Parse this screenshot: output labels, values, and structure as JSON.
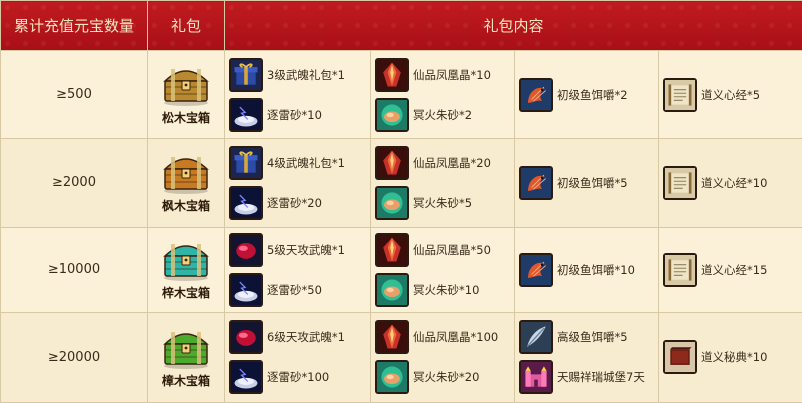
{
  "header": {
    "col_amount": "累计充值元宝数量",
    "col_pack": "礼包",
    "col_contents": "礼包内容"
  },
  "rows": [
    {
      "threshold": "≥500",
      "box": {
        "name": "松木宝箱",
        "color": "#b8892f"
      },
      "items": [
        [
          {
            "icon": "gift-box-icon",
            "label": "3级武魄礼包*1"
          },
          {
            "icon": "thunder-sand-icon",
            "label": "逐雷砂*10"
          }
        ],
        [
          {
            "icon": "phoenix-crystal-icon",
            "label": "仙品凤凰晶*10"
          },
          {
            "icon": "cinnabar-icon",
            "label": "冥火朱砂*2"
          }
        ],
        [
          {
            "icon": "shrimp-bait-icon",
            "label": "初级鱼饵嚼*2"
          }
        ],
        [
          {
            "icon": "scroll-book-icon",
            "label": "道义心经*5"
          }
        ]
      ]
    },
    {
      "threshold": "≥2000",
      "box": {
        "name": "枫木宝箱",
        "color": "#c67a22"
      },
      "items": [
        [
          {
            "icon": "gift-box-icon",
            "label": "4级武魄礼包*1"
          },
          {
            "icon": "thunder-sand-icon",
            "label": "逐雷砂*20"
          }
        ],
        [
          {
            "icon": "phoenix-crystal-icon",
            "label": "仙品凤凰晶*20"
          },
          {
            "icon": "cinnabar-icon",
            "label": "冥火朱砂*5"
          }
        ],
        [
          {
            "icon": "shrimp-bait-icon",
            "label": "初级鱼饵嚼*5"
          }
        ],
        [
          {
            "icon": "scroll-book-icon",
            "label": "道义心经*10"
          }
        ]
      ]
    },
    {
      "threshold": "≥10000",
      "box": {
        "name": "梓木宝箱",
        "color": "#2fb5a8"
      },
      "items": [
        [
          {
            "icon": "red-gem-icon",
            "label": "5级天攻武魄*1"
          },
          {
            "icon": "thunder-sand-icon",
            "label": "逐雷砂*50"
          }
        ],
        [
          {
            "icon": "phoenix-crystal-icon",
            "label": "仙品凤凰晶*50"
          },
          {
            "icon": "cinnabar-icon",
            "label": "冥火朱砂*10"
          }
        ],
        [
          {
            "icon": "shrimp-bait-icon",
            "label": "初级鱼饵嚼*10"
          }
        ],
        [
          {
            "icon": "scroll-book-icon",
            "label": "道义心经*15"
          }
        ]
      ]
    },
    {
      "threshold": "≥20000",
      "box": {
        "name": "樟木宝箱",
        "color": "#4eaa2c"
      },
      "items": [
        [
          {
            "icon": "red-gem-icon",
            "label": "6级天攻武魄*1"
          },
          {
            "icon": "thunder-sand-icon",
            "label": "逐雷砂*100"
          }
        ],
        [
          {
            "icon": "phoenix-crystal-icon",
            "label": "仙品凤凰晶*100"
          },
          {
            "icon": "cinnabar-icon",
            "label": "冥火朱砂*20"
          }
        ],
        [
          {
            "icon": "feather-bait-icon",
            "label": "高级鱼饵嚼*5"
          },
          {
            "icon": "castle-icon",
            "label": "天赐祥瑞城堡7天"
          }
        ],
        [
          {
            "icon": "secret-book-icon",
            "label": "道义秘典*10"
          }
        ]
      ]
    }
  ]
}
